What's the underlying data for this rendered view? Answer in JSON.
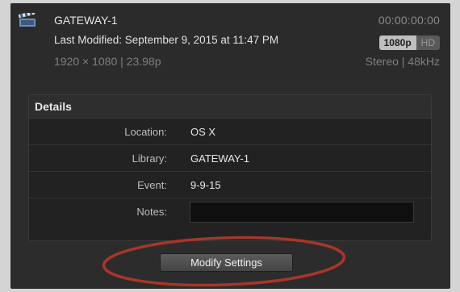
{
  "clip": {
    "icon": "clapperboard-icon",
    "name": "GATEWAY-1",
    "timecode": "00:00:00:00",
    "last_modified": "Last Modified: September 9, 2015 at 11:47 PM",
    "resolution_badge": "1080p",
    "hd_badge": "HD",
    "specs": "1920 × 1080  |  23.98p",
    "audio": "Stereo  |  48kHz"
  },
  "details": {
    "title": "Details",
    "rows": [
      {
        "label": "Location:",
        "value": "OS X"
      },
      {
        "label": "Library:",
        "value": "GATEWAY-1"
      },
      {
        "label": "Event:",
        "value": "9-9-15"
      }
    ],
    "notes_label": "Notes:",
    "notes_value": ""
  },
  "buttons": {
    "modify_settings": "Modify Settings"
  },
  "colors": {
    "panel_bg": "#2c2c2c",
    "page_bg": "#d4d4d4",
    "annotation_circle": "#a8362a"
  }
}
